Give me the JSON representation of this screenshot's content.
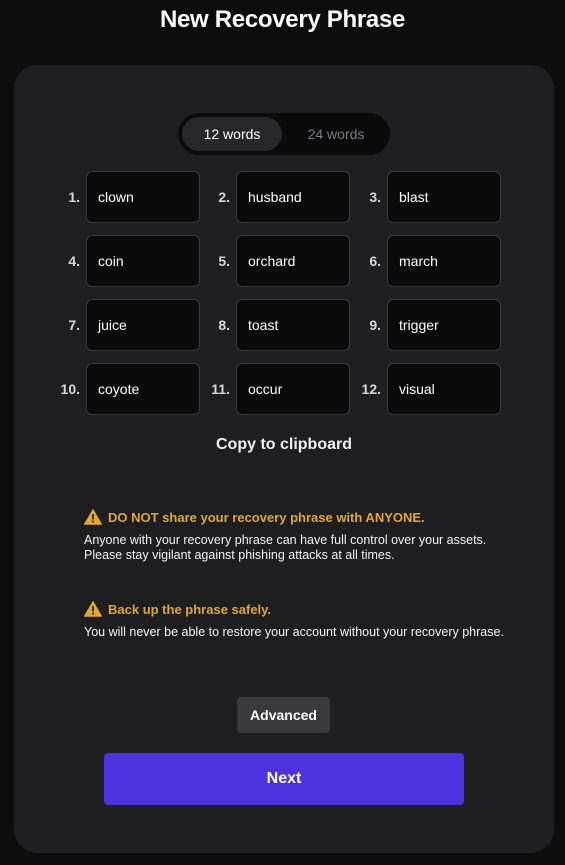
{
  "header": {
    "title": "New Recovery Phrase"
  },
  "toggle": {
    "option_12": "12 words",
    "option_24": "24 words",
    "selected": "12 words"
  },
  "phrase": {
    "words": [
      {
        "num": "1.",
        "word": "clown"
      },
      {
        "num": "2.",
        "word": "husband"
      },
      {
        "num": "3.",
        "word": "blast"
      },
      {
        "num": "4.",
        "word": "coin"
      },
      {
        "num": "5.",
        "word": "orchard"
      },
      {
        "num": "6.",
        "word": "march"
      },
      {
        "num": "7.",
        "word": "juice"
      },
      {
        "num": "8.",
        "word": "toast"
      },
      {
        "num": "9.",
        "word": "trigger"
      },
      {
        "num": "10.",
        "word": "coyote"
      },
      {
        "num": "11.",
        "word": "occur"
      },
      {
        "num": "12.",
        "word": "visual"
      }
    ]
  },
  "copy_label": "Copy to clipboard",
  "warnings": [
    {
      "icon": "warning-triangle-icon",
      "heading": "DO NOT share your recovery phrase with ANYONE.",
      "body": "Anyone with your recovery phrase can have full control over your assets. Please stay vigilant against phishing attacks at all times."
    },
    {
      "icon": "warning-triangle-icon",
      "heading": "Back up the phrase safely.",
      "body": "You will never be able to restore your account without your recovery phrase."
    }
  ],
  "buttons": {
    "advanced": "Advanced",
    "next": "Next"
  },
  "colors": {
    "accent": "#4d33e0",
    "warning": "#e3a82b",
    "card": "#1e1e20",
    "background": "#0c0c0d"
  }
}
